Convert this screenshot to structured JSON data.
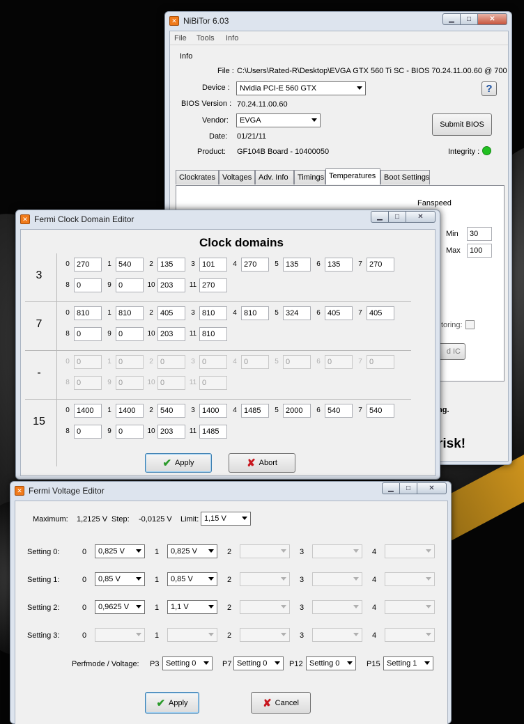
{
  "colors": {
    "accent": "#f07a1a",
    "ok": "#22c022",
    "check": "#2a9a2a",
    "abort": "#c8161e"
  },
  "main": {
    "title": "NiBiTor 6.03",
    "menu": [
      "File",
      "Tools",
      "Info"
    ],
    "info_group": "Info",
    "file_label": "File :",
    "file_value": "C:\\Users\\Rated-R\\Desktop\\EVGA GTX 560 Ti SC - BIOS 70.24.11.00.60 @ 700",
    "device_label": "Device :",
    "device_value": "Nvidia PCI-E 560 GTX",
    "bios_label": "BIOS Version :",
    "bios_value": "70.24.11.00.60",
    "vendor_label": "Vendor:",
    "vendor_value": "EVGA",
    "date_label": "Date:",
    "date_value": "01/21/11",
    "product_label": "Product:",
    "product_value": "GF104B Board - 10400050",
    "help": "?",
    "submit": "Submit BIOS",
    "integrity": "Integrity :",
    "tabs": [
      "Clockrates",
      "Voltages",
      "Adv. Info",
      "Timings",
      "Temperatures",
      "Boot Settings"
    ],
    "fanspeed": "Fanspeed",
    "min_label": "Min",
    "min_value": "30",
    "max_label": "Max",
    "max_value": "100",
    "partial1": "toring:",
    "partial2": "d IC",
    "partial3": "ng.",
    "partial4": "risk!"
  },
  "clock": {
    "title": "Fermi Clock Domain Editor",
    "heading": "Clock domains",
    "rows": [
      {
        "label": "3",
        "disabled": false,
        "values": [
          "270",
          "540",
          "135",
          "101",
          "270",
          "135",
          "135",
          "270",
          "0",
          "0",
          "203",
          "270"
        ]
      },
      {
        "label": "7",
        "disabled": false,
        "values": [
          "810",
          "810",
          "405",
          "810",
          "810",
          "324",
          "405",
          "405",
          "0",
          "0",
          "203",
          "810"
        ]
      },
      {
        "label": "-",
        "disabled": true,
        "values": [
          "0",
          "0",
          "0",
          "0",
          "0",
          "0",
          "0",
          "0",
          "0",
          "0",
          "0",
          "0"
        ]
      },
      {
        "label": "15",
        "disabled": false,
        "values": [
          "1400",
          "1400",
          "540",
          "1400",
          "1485",
          "2000",
          "540",
          "540",
          "0",
          "0",
          "203",
          "1485"
        ]
      }
    ],
    "indices": [
      "0",
      "1",
      "2",
      "3",
      "4",
      "5",
      "6",
      "7",
      "8",
      "9",
      "10",
      "11"
    ],
    "apply": "Apply",
    "abort": "Abort"
  },
  "volt": {
    "title": "Fermi Voltage Editor",
    "max_label": "Maximum:",
    "max_value": "1,2125 V",
    "step_label": "Step:",
    "step_value": "-0,0125 V",
    "limit_label": "Limit:",
    "limit_value": "1,15 V",
    "settings": [
      {
        "label": "Setting 0:",
        "values": [
          "0,825 V",
          "0,825 V",
          "",
          "",
          ""
        ]
      },
      {
        "label": "Setting 1:",
        "values": [
          "0,85 V",
          "0,85 V",
          "",
          "",
          ""
        ]
      },
      {
        "label": "Setting 2:",
        "values": [
          "0,9625 V",
          "1,1 V",
          "",
          "",
          ""
        ]
      },
      {
        "label": "Setting 3:",
        "values": [
          "",
          "",
          "",
          "",
          ""
        ]
      }
    ],
    "indices": [
      "0",
      "1",
      "2",
      "3",
      "4"
    ],
    "perf_label": "Perfmode / Voltage:",
    "perf": [
      {
        "label": "P3",
        "value": "Setting 0"
      },
      {
        "label": "P7",
        "value": "Setting 0"
      },
      {
        "label": "P12",
        "value": "Setting 0"
      },
      {
        "label": "P15",
        "value": "Setting 1"
      }
    ],
    "apply": "Apply",
    "cancel": "Cancel"
  }
}
